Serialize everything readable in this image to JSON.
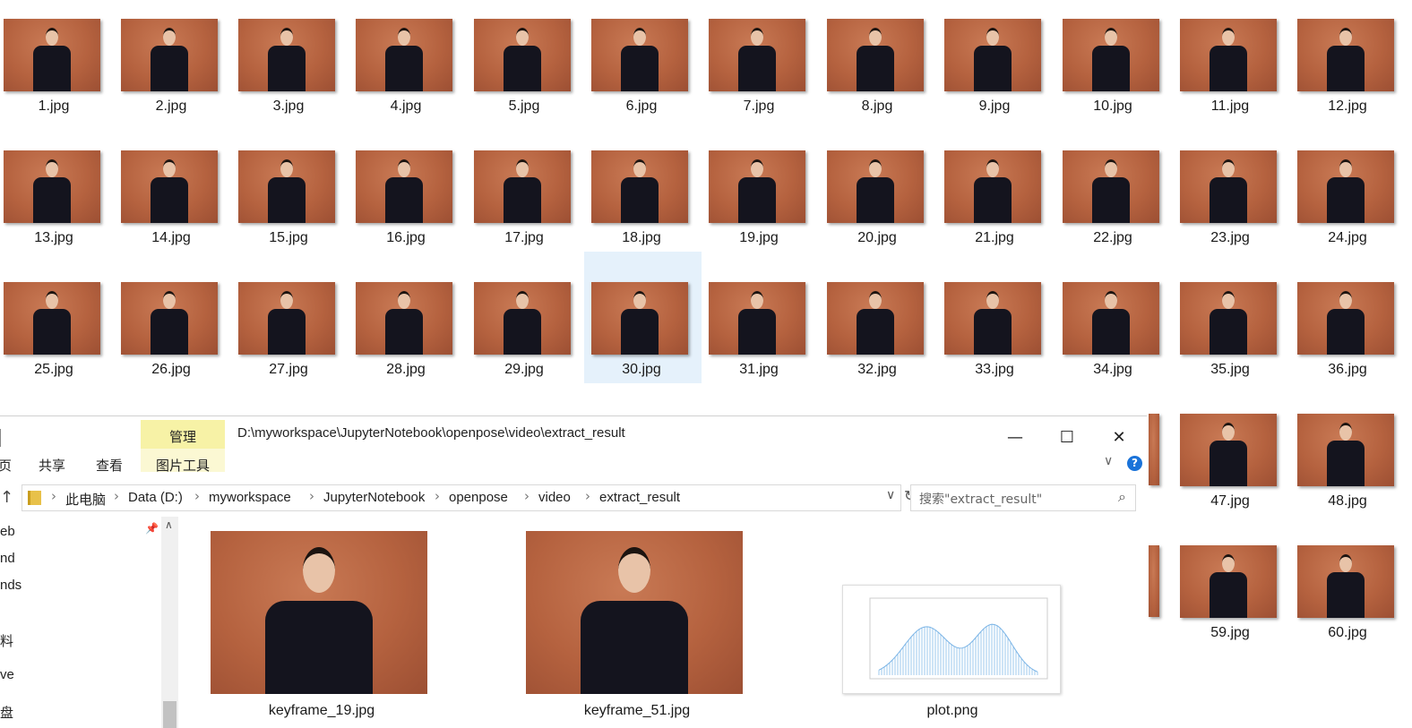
{
  "background_files": {
    "names": [
      "1.jpg",
      "2.jpg",
      "3.jpg",
      "4.jpg",
      "5.jpg",
      "6.jpg",
      "7.jpg",
      "8.jpg",
      "9.jpg",
      "10.jpg",
      "11.jpg",
      "12.jpg",
      "13.jpg",
      "14.jpg",
      "15.jpg",
      "16.jpg",
      "17.jpg",
      "18.jpg",
      "19.jpg",
      "20.jpg",
      "21.jpg",
      "22.jpg",
      "23.jpg",
      "24.jpg",
      "25.jpg",
      "26.jpg",
      "27.jpg",
      "28.jpg",
      "29.jpg",
      "30.jpg",
      "31.jpg",
      "32.jpg",
      "33.jpg",
      "34.jpg",
      "35.jpg",
      "36.jpg"
    ],
    "right_column": [
      "47.jpg",
      "48.jpg",
      "59.jpg",
      "60.jpg"
    ],
    "selected": "30.jpg"
  },
  "window": {
    "context_tab": "管理",
    "context_sub_tab": "图片工具",
    "title_path": "D:\\myworkspace\\JupyterNotebook\\openpose\\video\\extract_result",
    "tabs": [
      "页",
      "共享",
      "查看"
    ],
    "minimize_icon": "—",
    "maximize_icon": "☐",
    "close_icon": "✕",
    "breadcrumb": [
      "此电脑",
      "Data (D:)",
      "myworkspace",
      "JupyterNotebook",
      "openpose",
      "video",
      "extract_result"
    ],
    "search_placeholder": "搜索\"extract_result\"",
    "nav_items": [
      "eb",
      "nd",
      "nds",
      "",
      "料",
      "ve",
      "盘"
    ],
    "files": [
      "keyframe_19.jpg",
      "keyframe_51.jpg",
      "plot.png"
    ],
    "help_icon": "?"
  },
  "colors": {
    "accent": "#1a73d9",
    "context_tab": "#f7f2a6",
    "selection": "#e5f1fb",
    "photo_bg": "#b5623f"
  }
}
